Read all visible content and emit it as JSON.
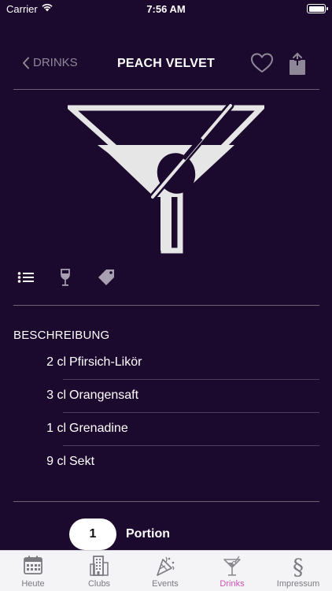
{
  "status_bar": {
    "carrier": "Carrier",
    "time": "7:56 AM"
  },
  "nav": {
    "back_label": "DRINKS",
    "title": "PEACH VELVET"
  },
  "detail_tabs": [
    {
      "icon": "list-icon"
    },
    {
      "icon": "wine-glass-icon"
    },
    {
      "icon": "tag-icon"
    }
  ],
  "section_title": "BESCHREIBUNG",
  "ingredients": [
    {
      "amount": "2 cl",
      "name": "Pfirsich-Likör"
    },
    {
      "amount": "3 cl",
      "name": "Orangensaft"
    },
    {
      "amount": "1 cl",
      "name": "Grenadine"
    },
    {
      "amount": "9 cl",
      "name": "Sekt"
    }
  ],
  "portion": {
    "count": "1",
    "label": "Portion"
  },
  "tab_bar": {
    "items": [
      {
        "label": "Heute",
        "icon": "calendar-icon"
      },
      {
        "label": "Clubs",
        "icon": "building-icon"
      },
      {
        "label": "Events",
        "icon": "party-icon"
      },
      {
        "label": "Drinks",
        "icon": "cocktail-icon"
      },
      {
        "label": "Impressum",
        "icon": "section-sign-icon"
      }
    ],
    "active_index": 3
  },
  "colors": {
    "background": "#1c0a2e",
    "accent": "#d04fb4",
    "muted": "#8e8798"
  }
}
